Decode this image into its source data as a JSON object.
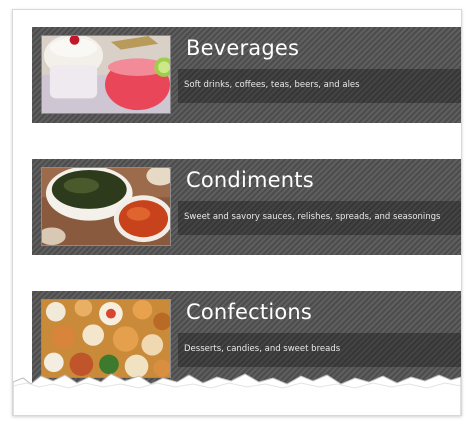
{
  "categories": [
    {
      "name": "Beverages",
      "description": "Soft drinks, coffees, teas, beers, and ales",
      "image": "beverages-photo"
    },
    {
      "name": "Condiments",
      "description": "Sweet and savory sauces, relishes, spreads, and seasonings",
      "image": "condiments-photo"
    },
    {
      "name": "Confections",
      "description": "Desserts, candies, and sweet breads",
      "image": "confections-photo"
    }
  ],
  "colors": {
    "card_background": "#555555",
    "title_text": "#ffffff",
    "description_text": "#e8e8e8",
    "thumbnail_border": "#8b8b8b"
  }
}
